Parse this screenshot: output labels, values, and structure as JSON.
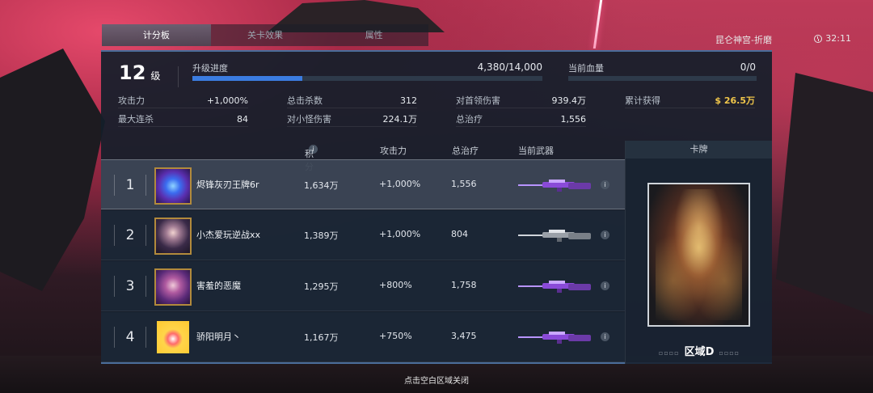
{
  "tabs": [
    {
      "label": "计分板",
      "active": true
    },
    {
      "label": "关卡效果",
      "active": false
    },
    {
      "label": "属性",
      "active": false
    }
  ],
  "location": "昆仑神宫-折磨",
  "timer": "32:11",
  "player": {
    "level": "12",
    "level_unit": "级",
    "progress_label": "升级进度",
    "progress_value": "4,380/14,000",
    "progress_fraction": 0.313,
    "hp_label": "当前血量",
    "hp_value": "0/0"
  },
  "stats": [
    {
      "key": "攻击力",
      "value": "+1,000%"
    },
    {
      "key": "总击杀数",
      "value": "312"
    },
    {
      "key": "对首领伤害",
      "value": "939.4万"
    },
    {
      "key": "累计获得",
      "value": "$ 26.5万"
    },
    {
      "key": "最大连杀",
      "value": "84"
    },
    {
      "key": "对小怪伤害",
      "value": "224.1万"
    },
    {
      "key": "总治疗",
      "value": "1,556"
    }
  ],
  "table": {
    "headers": {
      "score": "积分",
      "attack": "攻击力",
      "heal": "总治疗",
      "weapon": "当前武器",
      "card": "卡牌"
    },
    "rows": [
      {
        "rank": "1",
        "name": "烬锋灰刃王牌6r",
        "score": "1,634万",
        "attack": "+1,000%",
        "heal": "1,556",
        "selected": true
      },
      {
        "rank": "2",
        "name": "小杰爱玩逆战xx",
        "score": "1,389万",
        "attack": "+1,000%",
        "heal": "804",
        "selected": false
      },
      {
        "rank": "3",
        "name": "害羞的恶魔",
        "score": "1,295万",
        "attack": "+800%",
        "heal": "1,758",
        "selected": false
      },
      {
        "rank": "4",
        "name": "骄阳明月丶",
        "score": "1,167万",
        "attack": "+750%",
        "heal": "3,475",
        "selected": false
      }
    ]
  },
  "card": {
    "name": "区域D"
  },
  "close_hint": "点击空白区域关闭",
  "colors": {
    "accent_blue": "#3b7ce0",
    "gold": "#f0c64a",
    "panel_border": "#4a6d9a"
  }
}
